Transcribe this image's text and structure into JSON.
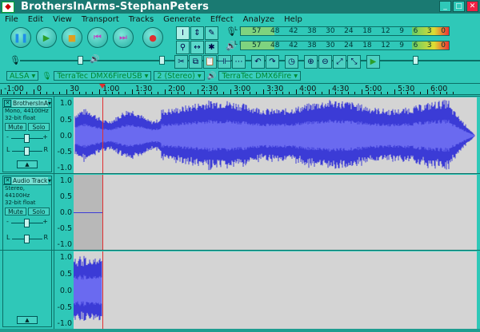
{
  "window": {
    "title": "BrothersInArms-StephanPeters",
    "controls": [
      "_",
      "□",
      "✕"
    ]
  },
  "menu": [
    "File",
    "Edit",
    "View",
    "Transport",
    "Tracks",
    "Generate",
    "Effect",
    "Analyze",
    "Help"
  ],
  "meters": {
    "ticks": [
      "57",
      "48",
      "42",
      "38",
      "30",
      "24",
      "18",
      "12",
      "9",
      "6",
      "3",
      "0"
    ],
    "playback_ticks": [
      "57",
      "48",
      "42",
      "38",
      "30",
      "24",
      "18",
      "12",
      "9",
      "6",
      "3",
      "0"
    ],
    "left_label": "L R",
    "right_label": "L R"
  },
  "devices": {
    "host": "ALSA",
    "input": "TerraTec DMX6FireUSB",
    "channels": "2 (Stereo)",
    "output": "TerraTec DMX6Fire"
  },
  "ruler": {
    "labels": [
      "-1:00",
      "0",
      "30",
      "1:00",
      "1:30",
      "2:00",
      "2:30",
      "3:00",
      "3:30",
      "4:00",
      "4:30",
      "5:00",
      "5:30",
      "6:00"
    ]
  },
  "tracks": [
    {
      "name": "BrothersInA",
      "info1": "Mono, 44100Hz",
      "info2": "32-bit float",
      "mute": "Mute",
      "solo": "Solo",
      "pan_left": "L",
      "pan_right": "R",
      "y_labels": [
        "1.0",
        "0.5",
        "0.0",
        "-0.5",
        "-1.0"
      ]
    },
    {
      "name": "Audio Track",
      "info1": "Stereo, 44100Hz",
      "info2": "32-bit float",
      "mute": "Mute",
      "solo": "Solo",
      "pan_left": "L",
      "pan_right": "R",
      "y_labels": [
        "1.0",
        "0.5",
        "0.0",
        "-0.5",
        "-1.0"
      ]
    },
    {
      "y_labels": [
        "1.0",
        "0.5",
        "0.0",
        "-0.5",
        "-1.0"
      ]
    }
  ],
  "colors": {
    "chrome": "#2fc8b8",
    "titlebar": "#1a7a72",
    "waveform": "#3b3bd6",
    "waveform_rms": "#6a6af0",
    "cursor": "#e03030",
    "track_bg": "#d4d4d4"
  }
}
